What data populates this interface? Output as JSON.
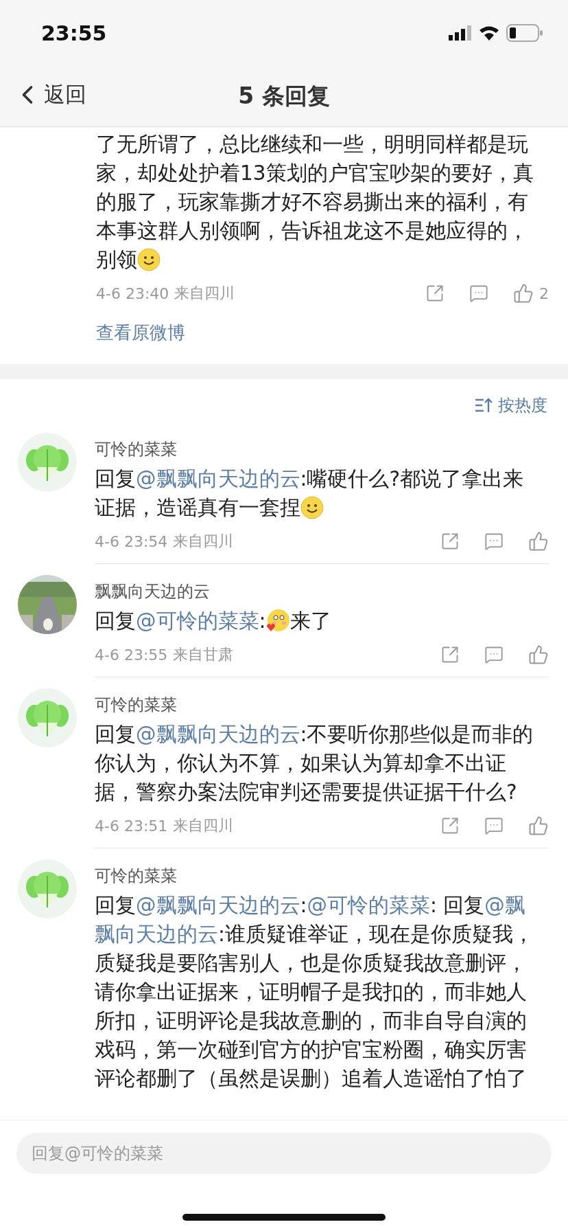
{
  "status_bar": {
    "time": "23:55"
  },
  "nav": {
    "back": "返回",
    "title": "5 条回复"
  },
  "root_comment": {
    "body": [
      {
        "kind": "text",
        "text": "了无所谓了，总比继续和一些，明明同样都是玩家，却处处护着13策划的户官宝吵架的要好，真的服了，玩家靠撕才好不容易撕出来的福利，有本事这群人别领啊，告诉祖龙这不是她应得的，别领"
      },
      {
        "kind": "smile"
      }
    ],
    "time": "4-6 23:40",
    "location": "来自四川",
    "likes": "2",
    "view_original": "查看原微博"
  },
  "sort": {
    "label": "按热度"
  },
  "replies": [
    {
      "author": "可怜的菜菜",
      "avatar": {
        "kind": "cabbage"
      },
      "body": [
        {
          "kind": "text",
          "text": "回复"
        },
        {
          "kind": "mention",
          "text": "@飘飘向天边的云"
        },
        {
          "kind": "text",
          "text": ":嘴硬什么?都说了拿出来证据，造谣真有一套捏"
        },
        {
          "kind": "smile"
        }
      ],
      "time": "4-6 23:54",
      "location": "来自四川"
    },
    {
      "author": "飘飘向天边的云",
      "body": [
        {
          "kind": "text",
          "text": "回复"
        },
        {
          "kind": "mention",
          "text": "@可怜的菜菜"
        },
        {
          "kind": "text",
          "text": ":"
        },
        {
          "kind": "blush"
        },
        {
          "kind": "text",
          "text": "来了"
        }
      ],
      "time": "4-6 23:55",
      "location": "来自甘肃"
    },
    {
      "author": "可怜的菜菜",
      "avatar": {
        "kind": "cabbage"
      },
      "body": [
        {
          "kind": "text",
          "text": "回复"
        },
        {
          "kind": "mention",
          "text": "@飘飘向天边的云"
        },
        {
          "kind": "text",
          "text": ":不要听你那些似是而非的你认为，你认为不算，如果认为算却拿不出证据，警察办案法院审判还需要提供证据干什么?"
        }
      ],
      "time": "4-6 23:51",
      "location": "来自四川"
    },
    {
      "author": "可怜的菜菜",
      "avatar": {
        "kind": "cabbage"
      },
      "body": [
        {
          "kind": "text",
          "text": "回复"
        },
        {
          "kind": "mention",
          "text": "@飘飘向天边的云"
        },
        {
          "kind": "text",
          "text": ":"
        },
        {
          "kind": "mention",
          "text": "@可怜的菜菜"
        },
        {
          "kind": "text",
          "text": ": 回复"
        },
        {
          "kind": "mention",
          "text": "@飘"
        },
        {
          "kind": "mention",
          "text": "飘向天边的云"
        },
        {
          "kind": "text",
          "text": ":谁质疑谁举证，现在是你质疑我，质疑我是要陷害别人，也是你质疑我故意删评，请你拿出证据来，证明帽子是我扣的，而非她人所扣，证明评论是我故意删的，而非自导自演的戏码，第一次碰到官方的护官宝粉圈，确实厉害评论都删了（虽然是误删）追着人造谣怕了怕了"
        }
      ]
    }
  ],
  "reply_box": {
    "placeholder": "回复@可怜的菜菜"
  }
}
